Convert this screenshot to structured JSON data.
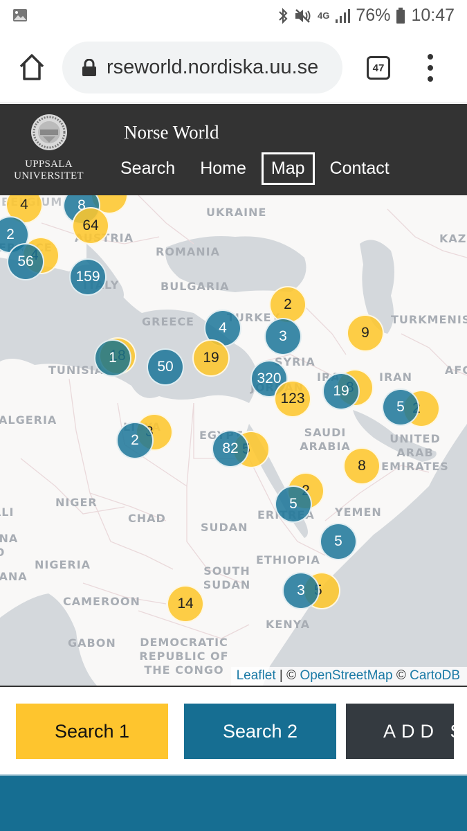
{
  "status_bar": {
    "battery": "76%",
    "time": "10:47",
    "network": "4G",
    "icons": [
      "gallery-icon",
      "bluetooth-icon",
      "mute-icon",
      "signal-icon",
      "battery-icon"
    ]
  },
  "browser": {
    "url": "rseworld.nordiska.uu.se",
    "tab_count": "47",
    "icons": [
      "home-icon",
      "lock-icon",
      "tabs-icon",
      "menu-icon"
    ]
  },
  "header": {
    "logo_line1": "UPPSALA",
    "logo_line2": "UNIVERSITET",
    "site_title": "Norse World",
    "nav": [
      {
        "label": "Search",
        "active": false
      },
      {
        "label": "Home",
        "active": false
      },
      {
        "label": "Map",
        "active": true
      },
      {
        "label": "Contact",
        "active": false
      }
    ]
  },
  "map": {
    "country_labels": [
      "BELGIUM",
      "AUSTRIA",
      "UKRAINE",
      "KAZ",
      "ROMANIA",
      "BULGARIA",
      "ITALY",
      "FRANCE",
      "GREECE",
      "TURKEY",
      "TURKMENIS",
      "TUNISIA",
      "SYRIA",
      "IRAN",
      "AFG",
      "JORDAN",
      "IRAQ",
      "ALGERIA",
      "LIBYA",
      "EGYPT",
      "SAUDI ARABIA",
      "UNITED ARAB EMIRATES",
      "NIGER",
      "CHAD",
      "SUDAN",
      "ERITREA",
      "YEMEN",
      "MALI",
      "BURKINA FASO",
      "NIGERIA",
      "ETHIOPIA",
      "SOUTH SUDAN",
      "GHANA",
      "CAMEROON",
      "KENYA",
      "GABON",
      "DEMOCRATIC REPUBLIC OF THE CONGO"
    ],
    "clusters": [
      {
        "count": "4",
        "series": "yellow"
      },
      {
        "count": "",
        "series": "yellow"
      },
      {
        "count": "8",
        "series": "blue"
      },
      {
        "count": "64",
        "series": "yellow"
      },
      {
        "count": "2",
        "series": "blue"
      },
      {
        "count": "4",
        "series": "yellow"
      },
      {
        "count": "56",
        "series": "blue"
      },
      {
        "count": "159",
        "series": "blue"
      },
      {
        "count": "2",
        "series": "yellow"
      },
      {
        "count": "4",
        "series": "blue"
      },
      {
        "count": "3",
        "series": "blue"
      },
      {
        "count": "9",
        "series": "yellow"
      },
      {
        "count": "18",
        "series": "yellow"
      },
      {
        "count": "1",
        "series": "blue"
      },
      {
        "count": "50",
        "series": "blue"
      },
      {
        "count": "19",
        "series": "yellow"
      },
      {
        "count": "320",
        "series": "blue"
      },
      {
        "count": "123",
        "series": "yellow"
      },
      {
        "count": "8",
        "series": "yellow"
      },
      {
        "count": "19",
        "series": "blue"
      },
      {
        "count": "2",
        "series": "yellow"
      },
      {
        "count": "5",
        "series": "blue"
      },
      {
        "count": "3",
        "series": "yellow"
      },
      {
        "count": "2",
        "series": "blue"
      },
      {
        "count": "5",
        "series": "yellow"
      },
      {
        "count": "82",
        "series": "blue"
      },
      {
        "count": "8",
        "series": "yellow"
      },
      {
        "count": "2",
        "series": "yellow"
      },
      {
        "count": "5",
        "series": "blue"
      },
      {
        "count": "5",
        "series": "blue"
      },
      {
        "count": "5",
        "series": "yellow"
      },
      {
        "count": "3",
        "series": "blue"
      },
      {
        "count": "14",
        "series": "yellow"
      }
    ],
    "attribution": {
      "leaflet": "Leaflet",
      "separator": " | © ",
      "osm": "OpenStreetMap",
      "copy": " © ",
      "carto": "CartoDB"
    }
  },
  "buttons": {
    "search1": "Search 1",
    "search2": "Search 2",
    "add": "ADD S"
  },
  "colors": {
    "header_bg": "#333333",
    "yellow": "#fec52e",
    "blue": "#166e92",
    "dark": "#343a40"
  }
}
